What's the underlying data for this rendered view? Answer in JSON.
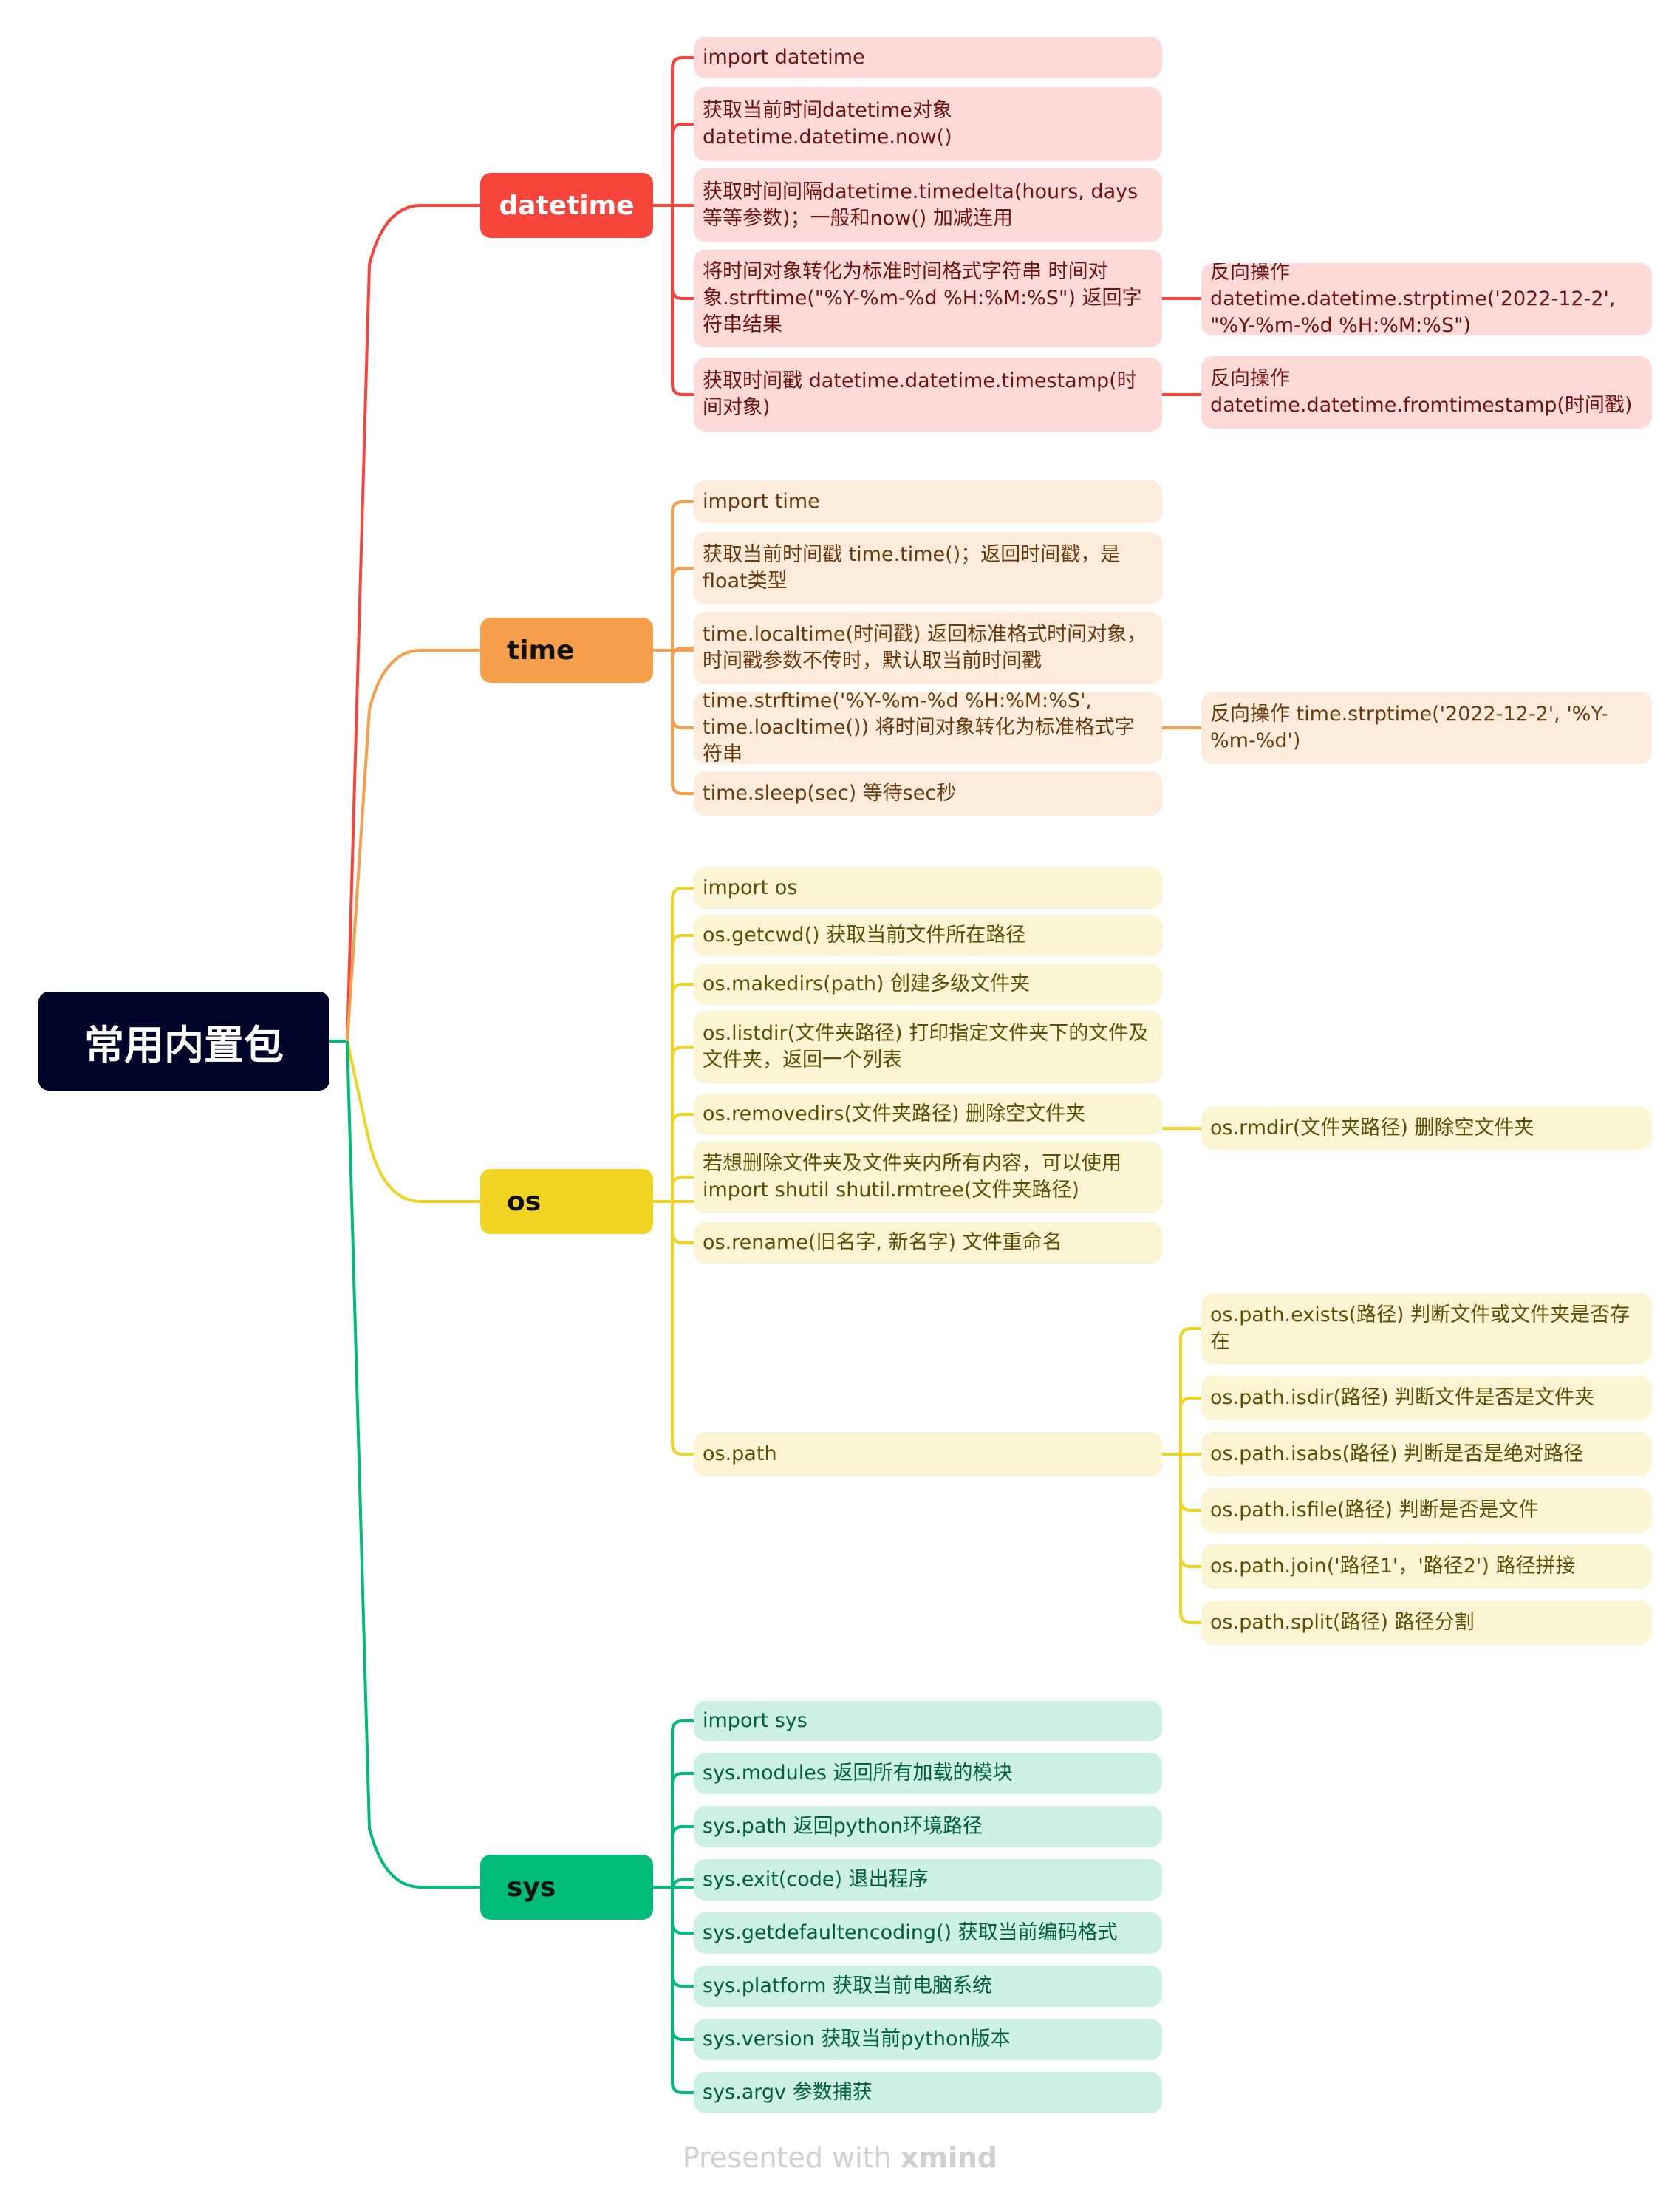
{
  "root": {
    "label": "常用内置包"
  },
  "colors": {
    "root_bg": "#000529",
    "datetime": "#f8453c",
    "time": "#f79e4a",
    "os": "#f0d323",
    "sys": "#00bb7a"
  },
  "branches": {
    "datetime": {
      "label": "datetime",
      "items": [
        "import datetime",
        "获取当前时间datetime对象  datetime.datetime.now()",
        "获取时间间隔datetime.timedelta(hours, days等等参数)；一般和now() 加减连用",
        "将时间对象转化为标准时间格式字符串 时间对象.strftime(\"%Y-%m-%d %H:%M:%S\") 返回字符串结果",
        "获取时间戳  datetime.datetime.timestamp(时间对象)"
      ],
      "sub_items": {
        "3": "反向操作 datetime.datetime.strptime('2022-12-2', \"%Y-%m-%d %H:%M:%S\")",
        "4": "反向操作 datetime.datetime.fromtimestamp(时间戳)"
      }
    },
    "time": {
      "label": "time",
      "items": [
        "import time",
        "获取当前时间戳  time.time()；返回时间戳，是float类型",
        "time.localtime(时间戳)  返回标准格式时间对象，时间戳参数不传时，默认取当前时间戳",
        "time.strftime('%Y-%m-%d %H:%M:%S', time.loacltime()) 将时间对象转化为标准格式字符串",
        "time.sleep(sec)  等待sec秒"
      ],
      "sub_items": {
        "3": "反向操作 time.strptime('2022-12-2', '%Y-%m-%d')"
      }
    },
    "os": {
      "label": "os",
      "items": [
        "import os",
        "os.getcwd() 获取当前文件所在路径",
        "os.makedirs(path)  创建多级文件夹",
        "os.listdir(文件夹路径)  打印指定文件夹下的文件及文件夹，返回一个列表",
        "os.removedirs(文件夹路径)  删除空文件夹",
        "若想删除文件夹及文件夹内所有内容，可以使用import shutil  shutil.rmtree(文件夹路径)",
        "os.rename(旧名字, 新名字)  文件重命名",
        "os.path"
      ],
      "sub_items": {
        "4": "os.rmdir(文件夹路径)  删除空文件夹"
      },
      "path_items": [
        "os.path.exists(路径)  判断文件或文件夹是否存在",
        "os.path.isdir(路径)  判断文件是否是文件夹",
        "os.path.isabs(路径)  判断是否是绝对路径",
        "os.path.isfile(路径)  判断是否是文件",
        "os.path.join('路径1'，'路径2')  路径拼接",
        "os.path.split(路径)  路径分割"
      ]
    },
    "sys": {
      "label": "sys",
      "items": [
        "import sys",
        "sys.modules  返回所有加载的模块",
        "sys.path  返回python环境路径",
        "sys.exit(code)  退出程序",
        "sys.getdefaultencoding()  获取当前编码格式",
        "sys.platform 获取当前电脑系统",
        "sys.version  获取当前python版本",
        "sys.argv  参数捕获"
      ]
    }
  },
  "footer": {
    "prefix": "Presented with ",
    "brand": "xmind"
  }
}
